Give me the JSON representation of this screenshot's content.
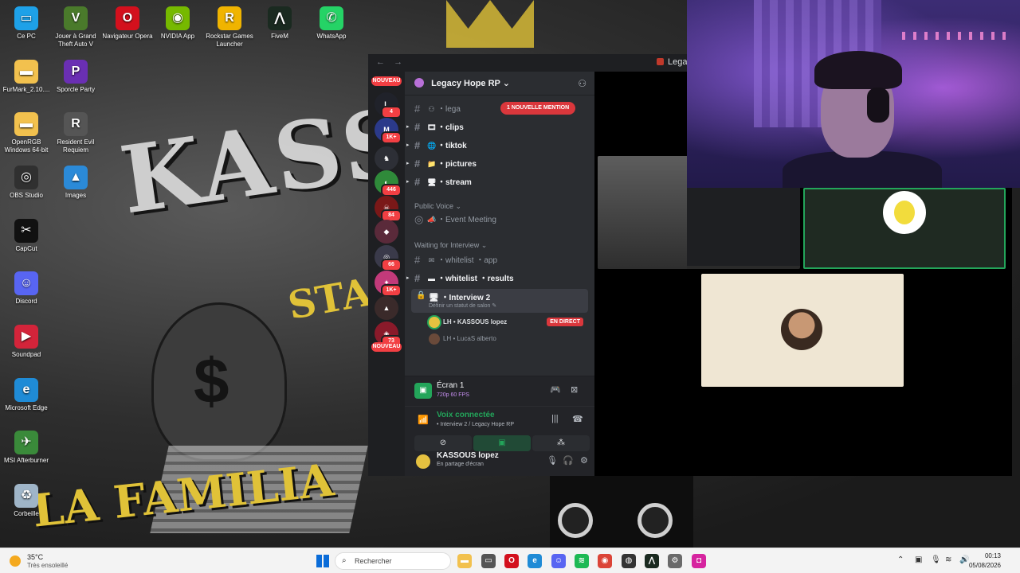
{
  "desktop": {
    "wallpaper": {
      "title": "KASSOU",
      "sub": "LA FAMILIA",
      "star": "STA FOCUS",
      "bag_symbol": "$"
    },
    "icons": [
      {
        "label": "Ce PC",
        "icon": "computer-icon",
        "color": "#1ea1e8",
        "glyph": "▭"
      },
      {
        "label": "Jouer à Grand Theft Auto V",
        "icon": "gta-icon",
        "color": "#4a7a2b",
        "glyph": "V"
      },
      {
        "label": "Navigateur Opera",
        "icon": "opera-icon",
        "color": "#d3101d",
        "glyph": "O"
      },
      {
        "label": "NVIDIA App",
        "icon": "nvidia-icon",
        "color": "#76b900",
        "glyph": "◉"
      },
      {
        "label": "Rockstar Games Launcher",
        "icon": "rockstar-icon",
        "color": "#f0b400",
        "glyph": "R"
      },
      {
        "label": "FiveM",
        "icon": "fivem-icon",
        "color": "#1a2a20",
        "glyph": "⋀"
      },
      {
        "label": "WhatsApp",
        "icon": "whatsapp-icon",
        "color": "#25d366",
        "glyph": "✆"
      },
      {
        "label": "FurMark_2.10....",
        "icon": "folder-icon",
        "color": "#f2c14e",
        "glyph": "▬"
      },
      {
        "label": "Sporcle Party",
        "icon": "sporcle-icon",
        "color": "#6a2fb3",
        "glyph": "P"
      },
      {
        "label": "OpenRGB Windows 64-bit",
        "icon": "folder-icon",
        "color": "#f2c14e",
        "glyph": "▬"
      },
      {
        "label": "Resident Evil Requiem",
        "icon": "resident-evil-icon",
        "color": "#555555",
        "glyph": "R"
      },
      {
        "label": "OBS Studio",
        "icon": "obs-icon",
        "color": "#303030",
        "glyph": "◎"
      },
      {
        "label": "Images",
        "icon": "images-icon",
        "color": "#2b8ad8",
        "glyph": "▲"
      },
      {
        "label": "CapCut",
        "icon": "capcut-icon",
        "color": "#111111",
        "glyph": "✂"
      },
      {
        "label": "Discord",
        "icon": "discord-icon",
        "color": "#5865f2",
        "glyph": "☺"
      },
      {
        "label": "Soundpad",
        "icon": "soundpad-icon",
        "color": "#d3243a",
        "glyph": "▶"
      },
      {
        "label": "Microsoft Edge",
        "icon": "edge-icon",
        "color": "#1f8bd6",
        "glyph": "e"
      },
      {
        "label": "MSI Afterburner",
        "icon": "afterburner-icon",
        "color": "#3a8a3a",
        "glyph": "✈"
      },
      {
        "label": "Corbeille",
        "icon": "recycle-bin-icon",
        "color": "#9fb5c8",
        "glyph": "♻"
      }
    ]
  },
  "discord": {
    "nav_back": "←",
    "nav_forward": "→",
    "window_title": "Legacy Hope RP",
    "guilds": [
      {
        "badge": "111",
        "color": "#8a1c1c",
        "glyph": "",
        "pill": "NOUVEAU"
      },
      {
        "badge": "4",
        "color": "#20222a",
        "glyph": "L"
      },
      {
        "badge": "1K+",
        "color": "#2b3a8a",
        "glyph": "M"
      },
      {
        "badge": "",
        "color": "#2d2f36",
        "glyph": "♞"
      },
      {
        "badge": "446",
        "color": "#2f8a3a",
        "glyph": "◐"
      },
      {
        "badge": "84",
        "color": "#7a1818",
        "glyph": "☠"
      },
      {
        "badge": "",
        "color": "#5a2a3a",
        "glyph": "◆"
      },
      {
        "badge": "66",
        "color": "#3a3a4a",
        "glyph": "◎"
      },
      {
        "badge": "1K+",
        "color": "#c23a7a",
        "glyph": "✦"
      },
      {
        "badge": "",
        "color": "#3a2a2a",
        "glyph": "▲"
      },
      {
        "badge": "73",
        "color": "#8a1a2a",
        "glyph": "◈"
      },
      {
        "badge": "",
        "color": "#8a1c1c",
        "glyph": "",
        "pill": "NOUVEAU"
      }
    ],
    "server": {
      "name": "Legacy Hope RP",
      "invite_icon": "add-member-icon"
    },
    "mention_pill": "1 NOUVELLE MENTION",
    "channels": [
      {
        "name": "・lega",
        "emoji": "⚇",
        "unread": false
      },
      {
        "name": "・clips",
        "emoji": "🎞",
        "unread": true
      },
      {
        "name": "・tiktok",
        "emoji": "🌐",
        "unread": true
      },
      {
        "name": "・pictures",
        "emoji": "📁",
        "unread": true
      },
      {
        "name": "・stream",
        "emoji": "🖥",
        "unread": true
      }
    ],
    "category_public_voice": "Public Voice",
    "event_meeting": "・Event Meeting",
    "category_waiting": "Waiting for Interview",
    "waiting_channels": [
      {
        "name": "・whitelist ・app",
        "emoji": "✉",
        "unread": false
      },
      {
        "name": "・whitelist ・results",
        "emoji": "▬",
        "unread": true
      }
    ],
    "active_channel": {
      "name": "・Interview 2",
      "status": "Définir un statut de salon"
    },
    "voice_users": [
      {
        "name": "LH • KASSOUS lopez",
        "live": "EN DIRECT",
        "color": "#e5c140"
      },
      {
        "name": "LH • LucaS alberto",
        "live": "",
        "color": "#6a4a3a"
      }
    ],
    "stream": {
      "title": "Écran 1",
      "sub": "720p 60 FPS"
    },
    "voice": {
      "title": "Voix connectée",
      "sub": "• Interview 2 / Legacy Hope RP"
    },
    "user": {
      "name": "KASSOUS lopez",
      "status": "En partage d'écran"
    }
  },
  "taskbar": {
    "temp": "35°C",
    "weather": "Très ensoleillé",
    "search_placeholder": "Rechercher",
    "time": "00:13",
    "date": "05/08/2026",
    "apps": [
      {
        "icon": "file-explorer-icon",
        "color": "#f2c14e",
        "glyph": "▬"
      },
      {
        "icon": "task-view-icon",
        "color": "#555555",
        "glyph": "▭"
      },
      {
        "icon": "opera-icon",
        "color": "#d3101d",
        "glyph": "O"
      },
      {
        "icon": "edge-icon",
        "color": "#1f8bd6",
        "glyph": "e"
      },
      {
        "icon": "discord-icon",
        "color": "#5865f2",
        "glyph": "☺"
      },
      {
        "icon": "spotify-icon",
        "color": "#1db954",
        "glyph": "≋"
      },
      {
        "icon": "chrome-icon",
        "color": "#db4437",
        "glyph": "◉"
      },
      {
        "icon": "steam-like-icon",
        "color": "#333333",
        "glyph": "◍"
      },
      {
        "icon": "fivem-icon",
        "color": "#1a2a20",
        "glyph": "⋀"
      },
      {
        "icon": "settings-icon",
        "color": "#6a6a6a",
        "glyph": "⚙"
      },
      {
        "icon": "instagram-icon",
        "color": "#d6249f",
        "glyph": "◘"
      }
    ]
  }
}
